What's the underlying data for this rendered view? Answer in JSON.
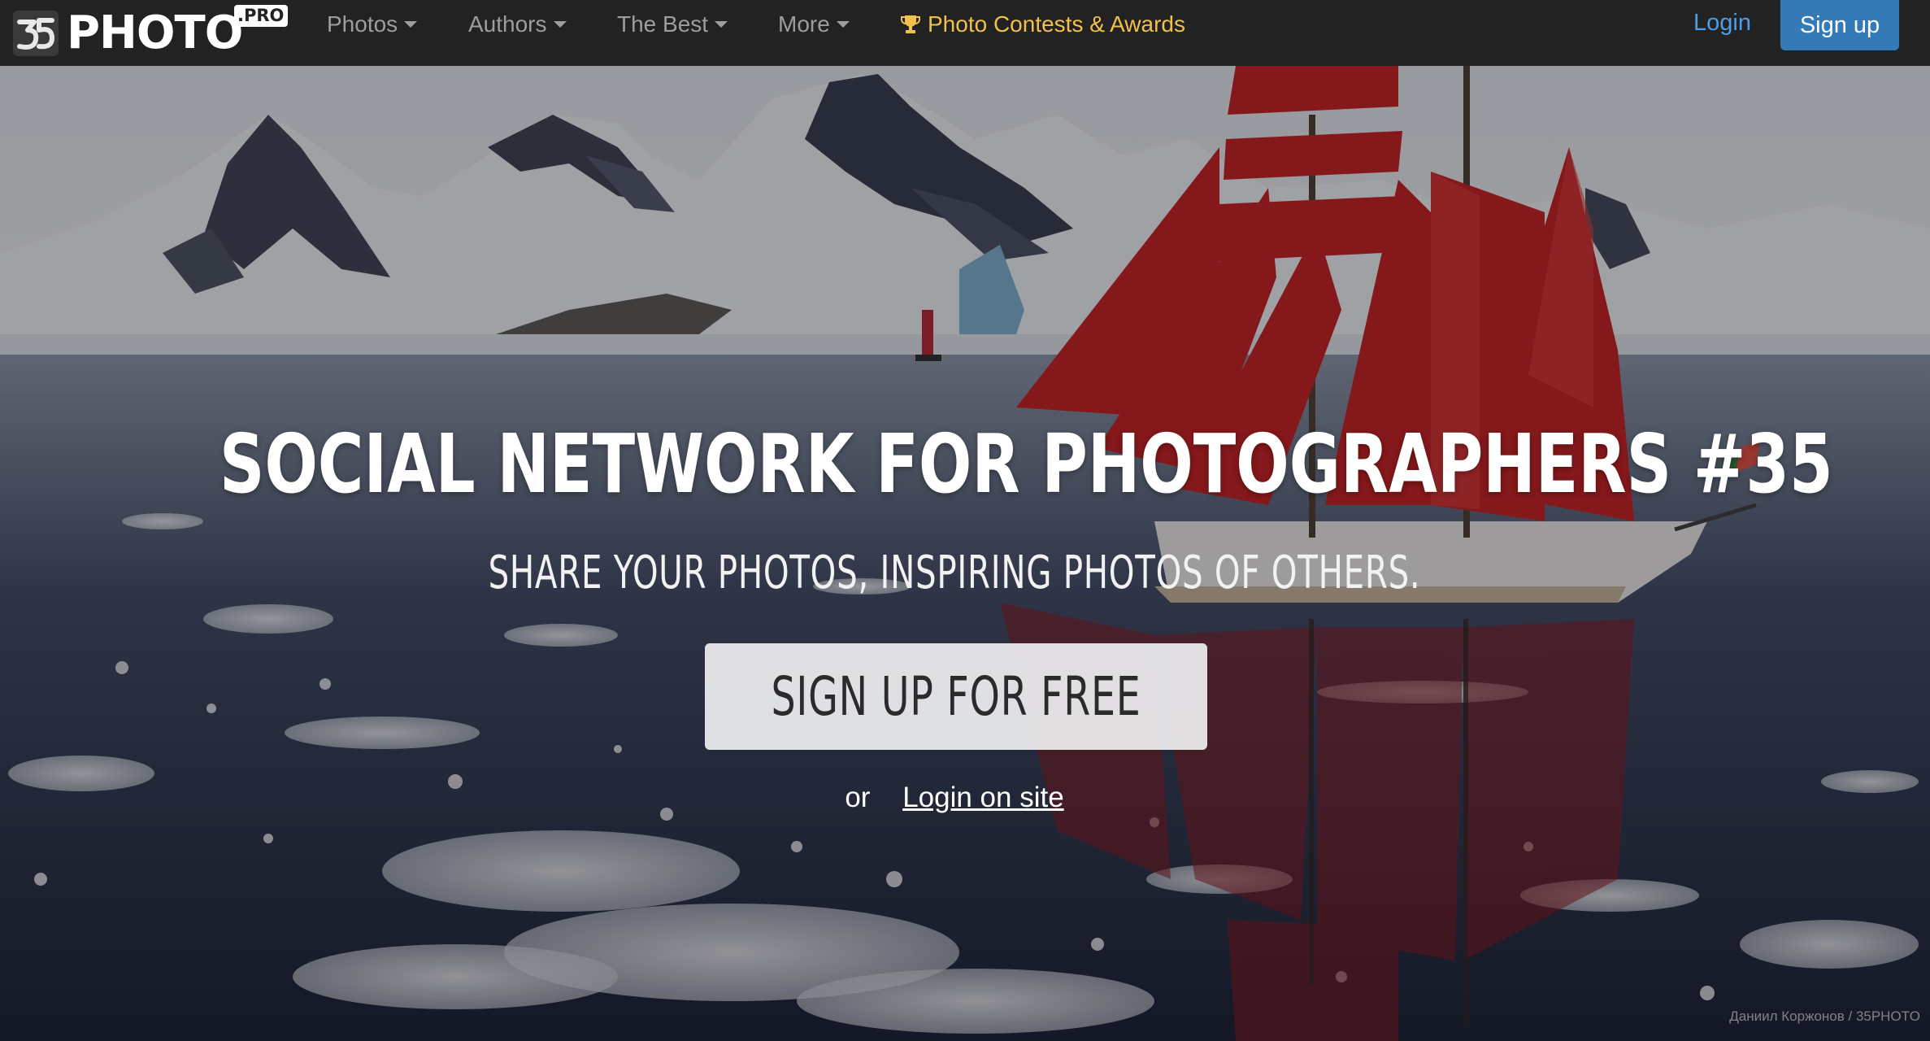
{
  "brand": {
    "name": "PHOTO",
    "badge": ".PRO"
  },
  "nav": {
    "photos": "Photos",
    "authors": "Authors",
    "the_best": "The Best",
    "more": "More",
    "contests": "Photo Contests & Awards",
    "login": "Login",
    "signup": "Sign up"
  },
  "hero": {
    "headline": "SOCIAL NETWORK FOR PHOTOGRAPHERS #35",
    "subline": "SHARE YOUR PHOTOS, INSPIRING PHOTOS OF OTHERS.",
    "cta": "SIGN UP FOR FREE",
    "or": "or",
    "login_link": "Login on site",
    "credit": "Даниил Коржонов / 35PHOTO"
  },
  "colors": {
    "navbar": "#222222",
    "nav_text": "#9d9d9d",
    "contests_accent": "#f0c04a",
    "login_blue": "#4a9fe8",
    "signup_blue": "#337ab7",
    "sail_red": "#c91a1a"
  },
  "icons": {
    "logo": "35photo-logo-icon",
    "dropdown": "caret-down-icon",
    "contests": "trophy-icon"
  }
}
